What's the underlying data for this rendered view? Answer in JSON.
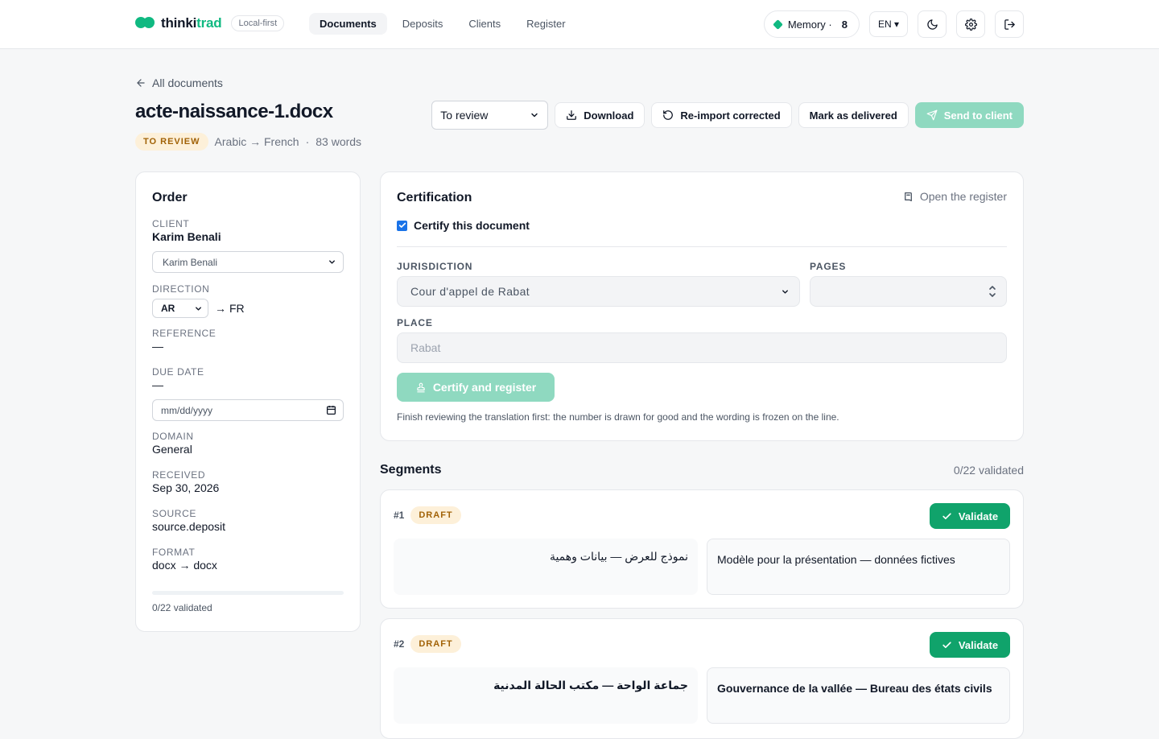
{
  "brand": {
    "name_part1": "thinki",
    "name_part2": "trad",
    "badge": "Local-first"
  },
  "nav": {
    "items": [
      {
        "label": "Documents",
        "active": true
      },
      {
        "label": "Deposits",
        "active": false
      },
      {
        "label": "Clients",
        "active": false
      },
      {
        "label": "Register",
        "active": false
      }
    ]
  },
  "topbar": {
    "memory_label": "Memory ·",
    "memory_count": "8",
    "language": "EN ▾"
  },
  "document": {
    "back_label": "All documents",
    "title": "acte-naissance-1.docx",
    "status_badge": "TO REVIEW",
    "language_pair": "Arabic → French",
    "separator": "·",
    "word_count": "83 words"
  },
  "actions": {
    "status_select": "To review",
    "download": "Download",
    "reimport": "Re-import corrected",
    "mark_delivered": "Mark as delivered",
    "send": "Send to client"
  },
  "order": {
    "title": "Order",
    "client_label": "CLIENT",
    "client_value": "Karim Benali",
    "client_select": "Karim Benali",
    "direction_label": "DIRECTION",
    "direction_source": "AR",
    "direction_arrow": "→",
    "direction_target": "FR",
    "reference_label": "REFERENCE",
    "reference_value": "—",
    "due_label": "DUE DATE",
    "due_value": "—",
    "due_placeholder": "mm/dd/yyyy",
    "domain_label": "DOMAIN",
    "domain_value": "General",
    "received_label": "RECEIVED",
    "received_value": "Sep 30, 2026",
    "source_label": "SOURCE",
    "source_value": "source.deposit",
    "format_label": "FORMAT",
    "format_value": "docx → docx",
    "progress_fraction": 0,
    "progress_text": "0/22 validated"
  },
  "certification": {
    "title": "Certification",
    "open_register": "Open the register",
    "certify_checkbox": "Certify this document",
    "certify_checked": true,
    "jurisdiction_label": "JURISDICTION",
    "jurisdiction_value": "Cour d'appel de Rabat",
    "pages_label": "PAGES",
    "pages_value": "",
    "place_label": "PLACE",
    "place_placeholder": "Rabat",
    "certify_button": "Certify and register",
    "hint": "Finish reviewing the translation first: the number is drawn for good and the wording is frozen on the line."
  },
  "segments": {
    "title": "Segments",
    "validated_count": "0/22 validated",
    "items": [
      {
        "number": "#1",
        "status": "DRAFT",
        "validate": "Validate",
        "source": "نموذج للعرض — بيانات وهمية",
        "target": "Modèle pour la présentation — données fictives"
      },
      {
        "number": "#2",
        "status": "DRAFT",
        "validate": "Validate",
        "source": "جماعة الواحة — مكتب الحالة المدنية",
        "target": "Gouvernance de la vallée — Bureau des états civils"
      }
    ]
  },
  "colors": {
    "accent": "#10b981",
    "validate": "#10a36b",
    "send_disabled": "#8fd9c0",
    "badge_bg": "#fdf0d9",
    "badge_text": "#a16207"
  },
  "icons": [
    "back-arrow-icon",
    "download-icon",
    "reimport-icon",
    "send-icon",
    "moon-icon",
    "gear-icon",
    "logout-icon",
    "book-icon",
    "stamp-icon",
    "check-icon",
    "chevron-down-icon",
    "calendar-icon",
    "spinner-icon"
  ]
}
